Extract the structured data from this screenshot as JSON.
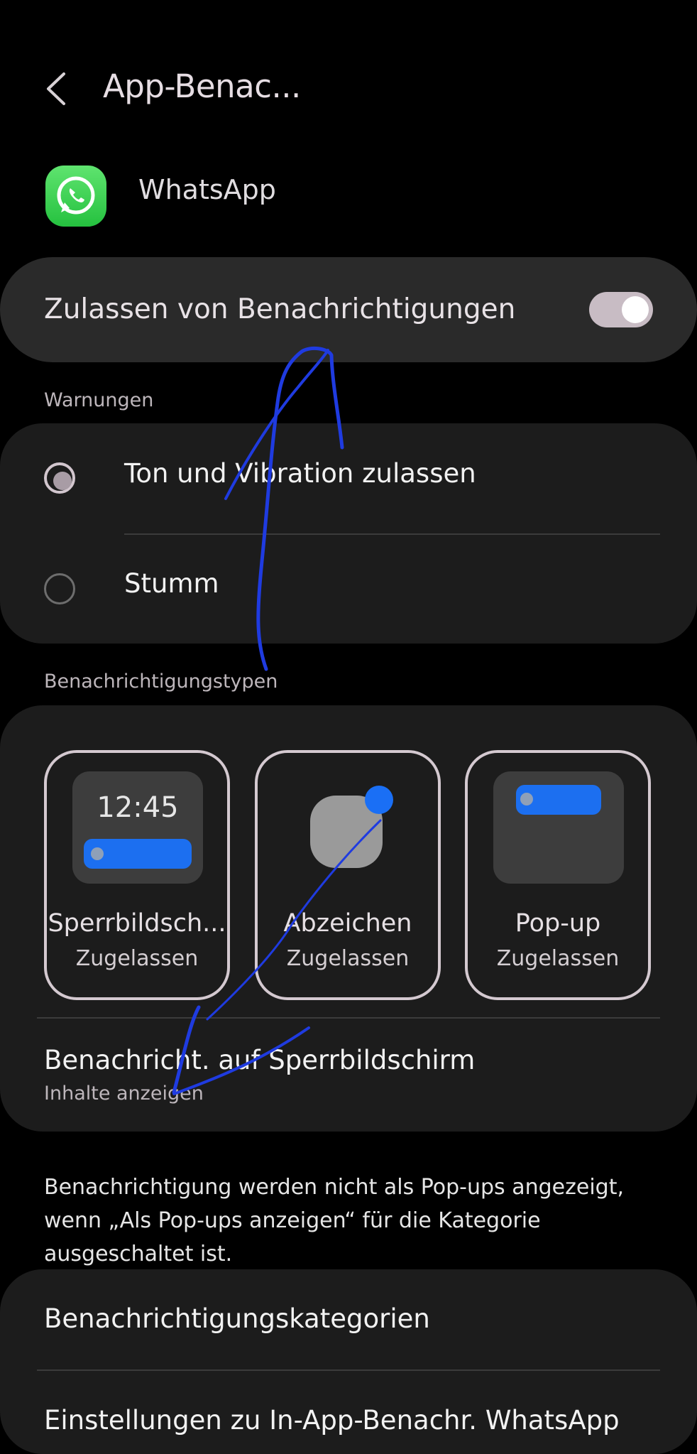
{
  "header": {
    "title": "App-Benac...",
    "back_icon": "chevron-left-icon"
  },
  "app": {
    "name": "WhatsApp",
    "icon": "whatsapp-icon",
    "icon_color": "#25D366"
  },
  "master": {
    "label": "Zulassen von Benachrichtigungen",
    "enabled": true
  },
  "alerts": {
    "section_label": "Warnungen",
    "options": [
      {
        "label": "Ton und Vibration zulassen",
        "selected": true
      },
      {
        "label": "Stumm",
        "selected": false
      }
    ]
  },
  "types": {
    "section_label": "Benachrichtigungstypen",
    "tiles": [
      {
        "title": "Sperrbildsch...",
        "status": "Zugelassen",
        "preview_time": "12:45"
      },
      {
        "title": "Abzeichen",
        "status": "Zugelassen"
      },
      {
        "title": "Pop-up",
        "status": "Zugelassen"
      }
    ],
    "lockscreen": {
      "title": "Benachricht. auf Sperrbildschirm",
      "value": "Inhalte anzeigen"
    }
  },
  "note": "Benachrichtigung werden nicht als Pop-ups angezeigt, wenn „Als Pop-ups anzeigen“ für die Kategorie ausgeschaltet ist.",
  "categories": {
    "label": "Benachrichtigungskategorien",
    "inapp_label": "Einstellungen zu In-App-Benachr. WhatsApp"
  },
  "colors": {
    "accent_blue": "#1A6FF5",
    "toggle_track": "#C8BCC4",
    "annotation_ink": "#1F3BE0"
  }
}
